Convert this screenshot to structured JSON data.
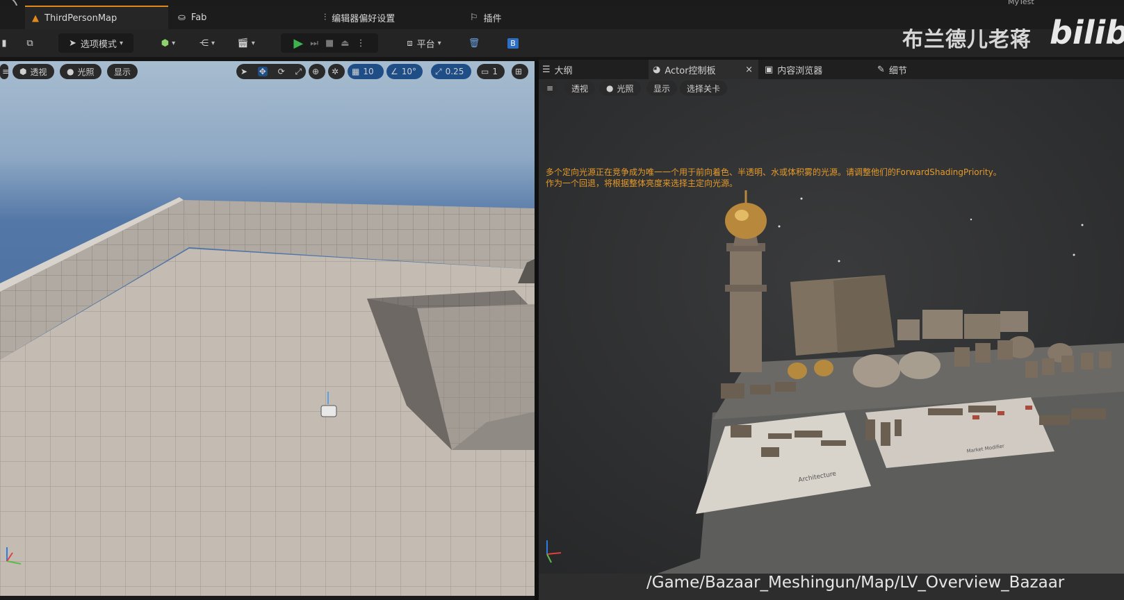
{
  "window": {
    "my_test": "MyTest",
    "document_tabs": [
      {
        "label": "ThirdPersonMap",
        "icon": "level-icon",
        "active": true
      },
      {
        "label": "Fab",
        "icon": "fab-icon"
      },
      {
        "label": "编辑器偏好设置",
        "icon": "sliders-icon"
      },
      {
        "label": "插件",
        "icon": "plug-icon"
      }
    ]
  },
  "toolbar": {
    "mode_label": "选项模式",
    "platform_label": "平台"
  },
  "watermark": {
    "text": "布兰德儿老蒋",
    "logo": "bilibi"
  },
  "left_viewport": {
    "perspective": "透视",
    "lighting": "光照",
    "show": "显示",
    "grid_snap": "10",
    "rotate_snap": "10°",
    "scale_snap": "0.25",
    "camera_speed": "1"
  },
  "right_panel": {
    "tabs": [
      {
        "label": "大纲",
        "icon": "outliner-icon"
      },
      {
        "label": "Actor控制板",
        "icon": "actor-palette-icon",
        "active": true
      },
      {
        "label": "内容浏览器",
        "icon": "content-browser-icon"
      },
      {
        "label": "细节",
        "icon": "details-icon"
      }
    ],
    "perspective": "透视",
    "lighting": "光照",
    "show": "显示",
    "select_level": "选择关卡",
    "warning_line1": "多个定向光源正在竞争成为唯一一个用于前向着色、半透明、水或体积雾的光源。请调整他们的ForwardShadingPriority。",
    "warning_line2": "作为一个回退，将根据整体亮度来选择主定向光源。",
    "level_path": "/Game/Bazaar_Meshingun/Map/LV_Overview_Bazaar",
    "scene_labels": [
      "Architecture",
      "Market Modifier"
    ]
  },
  "colors": {
    "accent_orange": "#e08a1e",
    "warning_text": "#e59a2a",
    "snap_blue": "#1f4e86",
    "play_green": "#3fb34f"
  }
}
